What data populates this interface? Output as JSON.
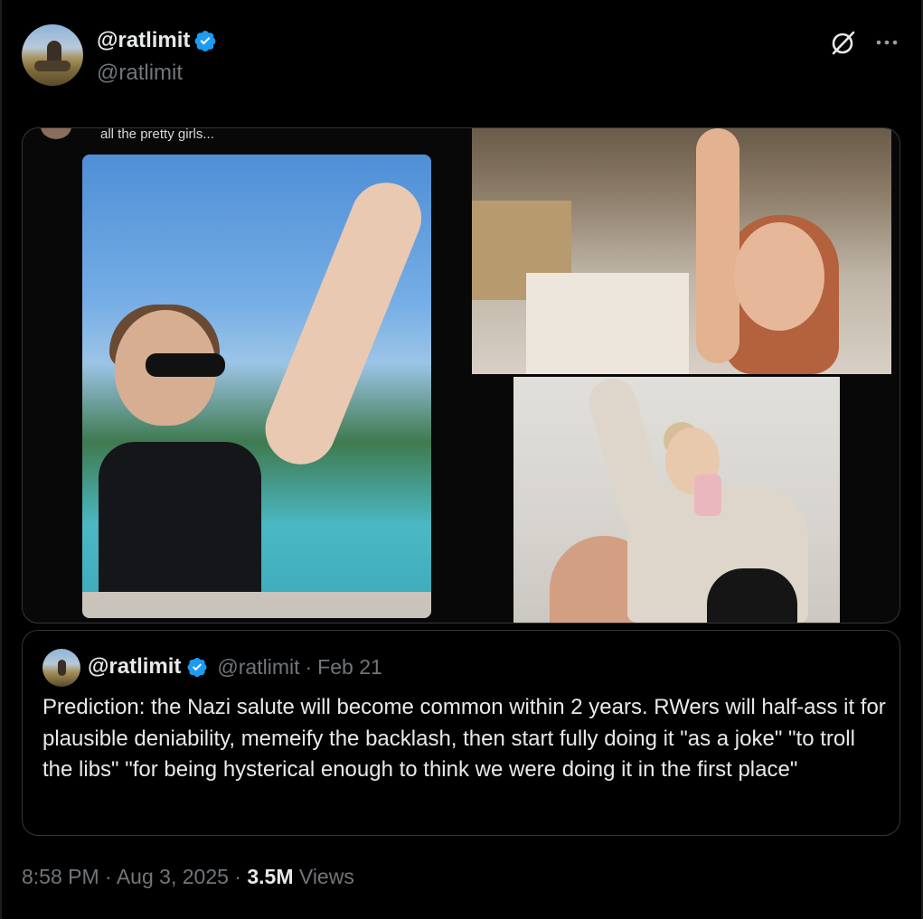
{
  "author": {
    "display_name": "@ratlimit",
    "handle": "@ratlimit"
  },
  "icons": {
    "verified": "verified-badge-icon",
    "grok": "grok-icon",
    "more": "more-options-icon"
  },
  "colors": {
    "background": "#000000",
    "verified_blue": "#1d9bf0",
    "muted_text": "#71767b",
    "border": "#333639"
  },
  "media": {
    "caption_text": "all the pretty girls..."
  },
  "quote": {
    "display_name": "@ratlimit",
    "handle": "@ratlimit",
    "separator": "·",
    "date": "Feb 21",
    "text": "Prediction: the Nazi salute will become common within 2 years. RWers will half-ass it for plausible deniability, memeify the backlash, then start fully doing it \"as a joke\" \"to troll the libs\" \"for being hysterical enough to think we were doing it in the first place\""
  },
  "footer": {
    "time": "8:58 PM",
    "separator": "·",
    "date": "Aug 3, 2025",
    "views_count": "3.5M",
    "views_label": "Views"
  }
}
